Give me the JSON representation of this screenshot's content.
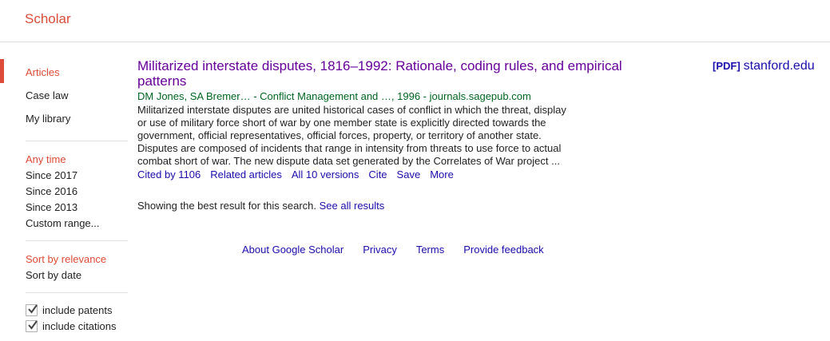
{
  "header": {
    "logo": "Scholar"
  },
  "sidebar": {
    "nav": [
      "Articles",
      "Case law",
      "My library"
    ],
    "time": [
      "Any time",
      "Since 2017",
      "Since 2016",
      "Since 2013",
      "Custom range..."
    ],
    "sort": [
      "Sort by relevance",
      "Sort by date"
    ],
    "options": [
      {
        "label": "include patents",
        "checked": true
      },
      {
        "label": "include citations",
        "checked": true
      }
    ]
  },
  "result": {
    "title": "Militarized interstate disputes, 1816–1992: Rationale, coding rules, and empirical patterns",
    "meta": "DM Jones, SA Bremer… - Conflict Management and …, 1996 - journals.sagepub.com",
    "snippet": "Militarized interstate disputes are united historical cases of conflict in which the threat, display or use of military force short of war by one member state is explicitly directed towards the government, official representatives, official forces, property, or territory of another state. Disputes are composed of incidents that range in intensity from threats to use force to actual combat short of war. The new dispute data set generated by the Correlates of War project ...",
    "links": [
      "Cited by 1106",
      "Related articles",
      "All 10 versions",
      "Cite",
      "Save",
      "More"
    ],
    "pdf_tag": "[PDF]",
    "pdf_domain": "stanford.edu"
  },
  "best_result": {
    "text": "Showing the best result for this search.",
    "link": "See all results"
  },
  "footer": [
    "About Google Scholar",
    "Privacy",
    "Terms",
    "Provide feedback"
  ],
  "colors": {
    "accent_red": "#dd4b39",
    "link_blue": "#1a0dab",
    "visited_purple": "#660099",
    "meta_green": "#006621"
  }
}
